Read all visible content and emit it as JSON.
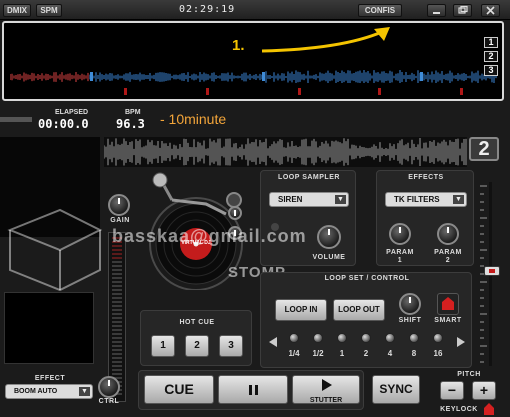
{
  "topbar": {
    "buttons": [
      "DMIX",
      "SPM"
    ],
    "clock": "02:29:19",
    "config_label": "CONFIS",
    "window_buttons": [
      "minimize-icon",
      "restore-icon",
      "close-icon"
    ]
  },
  "overview": {
    "annotation_number": "1.",
    "deck_buttons": [
      "1",
      "2",
      "3"
    ]
  },
  "readouts": {
    "elapsed_label": "ELAPSED",
    "elapsed_value": "00:00.0",
    "bpm_label": "BPM",
    "bpm_value": "96.3"
  },
  "annotation_text": "- 10minute",
  "deck_number": "2",
  "turntable": {
    "gain_label": "GAIN",
    "logo": "VIRTUAL DJ"
  },
  "loop_sampler": {
    "title": "LOOP SAMPLER",
    "selected": "SIREN",
    "volume_label": "VOLUME"
  },
  "effects": {
    "title": "EFFECTS",
    "selected": "TK FILTERS",
    "param1_label": "PARAM\n1",
    "param2_label": "PARAM\n2"
  },
  "watermark": "basskaa@gmail.com",
  "watermark2": "STOMP",
  "loop_control": {
    "title": "LOOP SET / CONTROL",
    "loop_in": "LOOP IN",
    "loop_out": "LOOP OUT",
    "shift_label": "SHIFT",
    "smart_label": "SMART",
    "lengths": [
      "1/4",
      "1/2",
      "1",
      "2",
      "4",
      "8",
      "16"
    ]
  },
  "hot_cue": {
    "title": "HOT CUE",
    "buttons": [
      "1",
      "2",
      "3"
    ]
  },
  "effect_select": {
    "label": "EFFECT",
    "selected": "BOOM AUTO",
    "ctrl_label": "CTRL"
  },
  "transport": {
    "cue": "CUE",
    "pause_icon": "pause-icon",
    "play_label": "STUTTER",
    "sync": "SYNC"
  },
  "pitch": {
    "label": "PITCH",
    "minus": "−",
    "plus": "+",
    "keylock": "KEYLOCK"
  },
  "colors": {
    "accent_yellow": "#f4c400",
    "record_red": "#c41c1c",
    "annotation_orange": "#f3a53a"
  }
}
